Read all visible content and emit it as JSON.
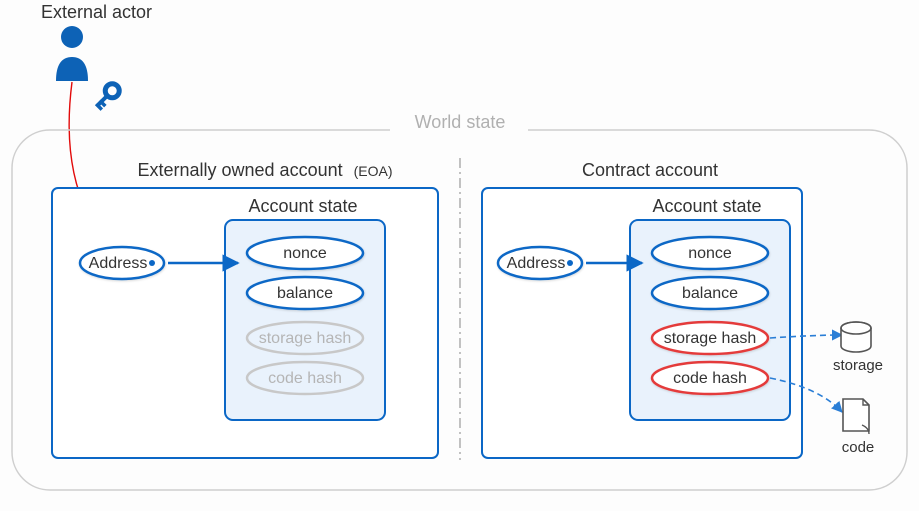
{
  "actor_label": "External actor",
  "world_state_label": "World state",
  "eoa": {
    "title": "Externally owned account",
    "title_suffix": "(EOA)",
    "account_state_label": "Account state",
    "address_label": "Address",
    "fields": {
      "nonce": "nonce",
      "balance": "balance",
      "storage_hash": "storage hash",
      "code_hash": "code hash"
    }
  },
  "contract": {
    "title": "Contract account",
    "account_state_label": "Account state",
    "address_label": "Address",
    "fields": {
      "nonce": "nonce",
      "balance": "balance",
      "storage_hash": "storage hash",
      "code_hash": "code hash"
    },
    "storage_icon_label": "storage",
    "code_icon_label": "code"
  },
  "colors": {
    "blue": "#0b67c6",
    "blue_fill": "#0d62b6",
    "light_blue": "#e9f2fc",
    "gray": "#b5b5b5",
    "red": "#e43b3b",
    "border_gray": "#cfcfcf",
    "red_link": "#e20b0b"
  }
}
